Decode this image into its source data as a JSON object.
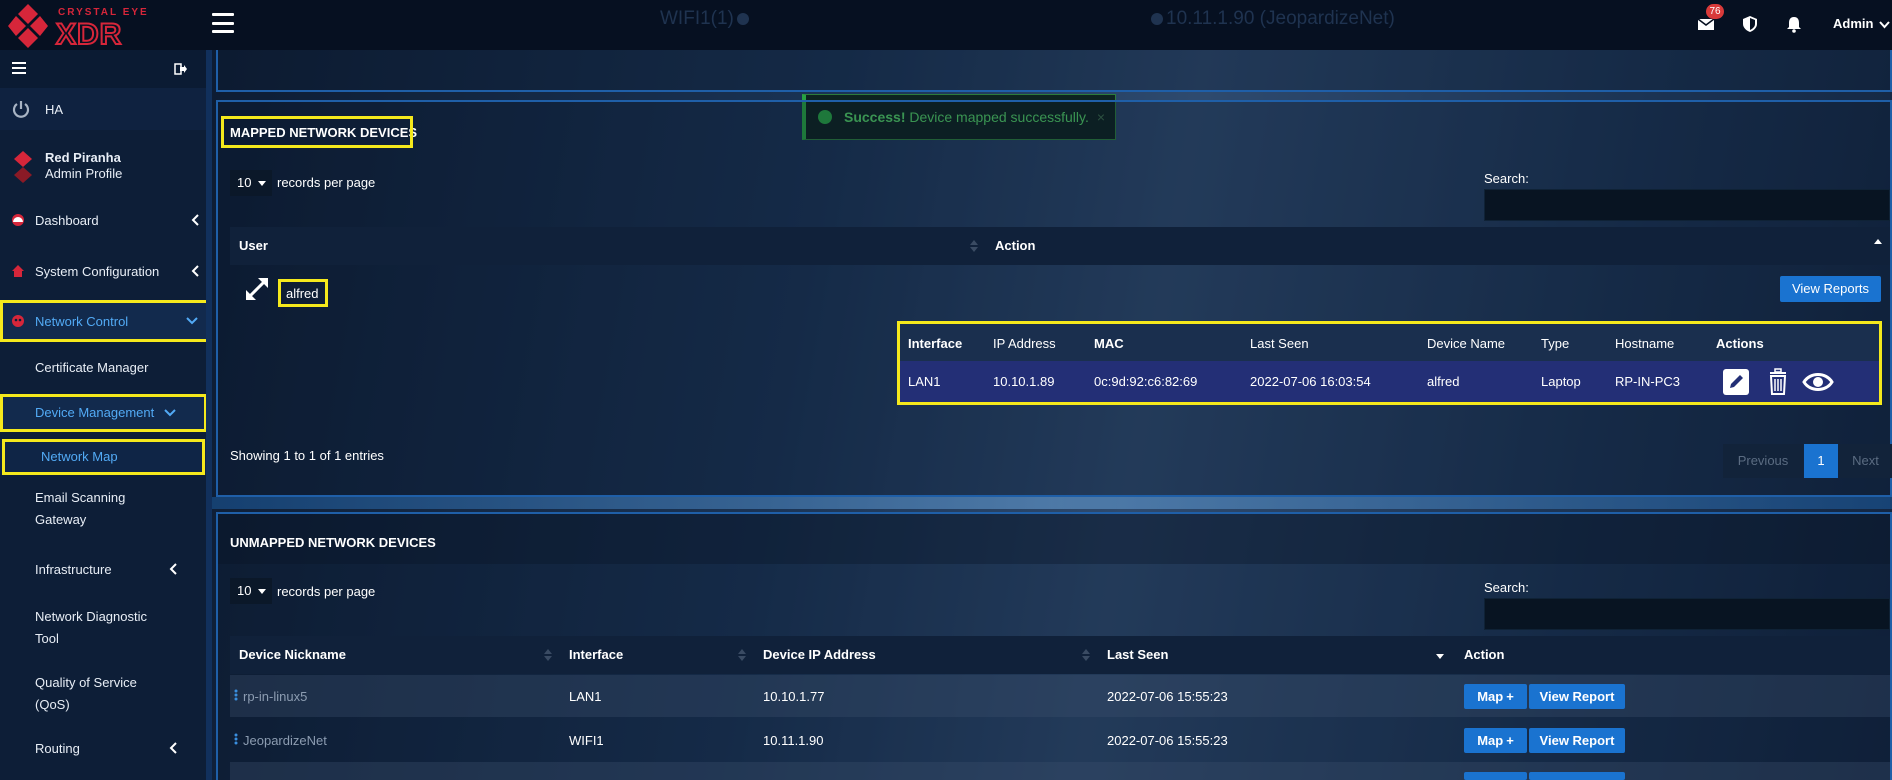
{
  "topbar": {
    "brand_top": "CRYSTAL EYE",
    "brand_main": "XDR",
    "status_left": "WIFI1(1)",
    "status_right": "10.11.1.90 (JeopardizeNet)",
    "mail_badge": "76",
    "user": "Admin"
  },
  "sidebar": {
    "ha_label": "HA",
    "profile_name": "Red Piranha",
    "profile_role": "Admin Profile",
    "items": [
      {
        "label": "Dashboard"
      },
      {
        "label": "System Configuration"
      },
      {
        "label": "Network Control"
      },
      {
        "label": "Certificate Manager"
      },
      {
        "label": "Device Management"
      },
      {
        "label": "Network Map"
      },
      {
        "label_1": "Email Scanning",
        "label_2": "Gateway"
      },
      {
        "label": "Infrastructure"
      },
      {
        "label_1": "Network Diagnostic",
        "label_2": "Tool"
      },
      {
        "label_1": "Quality of Service",
        "label_2": "(QoS)"
      },
      {
        "label": "Routing"
      }
    ]
  },
  "toast": {
    "strong": "Success!",
    "message": "Device mapped successfully.",
    "close": "×"
  },
  "mapped": {
    "title": "MAPPED NETWORK DEVICES",
    "rpp_value": "10",
    "rpp_text": "records per page",
    "search_label": "Search:",
    "search_value": "",
    "headers": {
      "user": "User",
      "action": "Action"
    },
    "row": {
      "user": "alfred",
      "view_reports": "View Reports"
    },
    "details": {
      "headers": [
        "Interface",
        "IP Address",
        "MAC",
        "Last Seen",
        "Device Name",
        "Type",
        "Hostname",
        "Actions"
      ],
      "row": [
        "LAN1",
        "10.10.1.89",
        "0c:9d:92:c6:82:69",
        "2022-07-06 16:03:54",
        "alfred",
        "Laptop",
        "RP-IN-PC3"
      ]
    },
    "showing": "Showing 1 to 1 of 1 entries",
    "pagination": {
      "prev": "Previous",
      "page": "1",
      "next": "Next"
    }
  },
  "unmapped": {
    "title": "UNMAPPED NETWORK DEVICES",
    "rpp_value": "10",
    "rpp_text": "records per page",
    "search_label": "Search:",
    "search_value": "",
    "headers": [
      "Device Nickname",
      "Interface",
      "Device IP Address",
      "Last Seen",
      "Action"
    ],
    "rows": [
      {
        "nickname": "rp-in-linux5",
        "interface": "LAN1",
        "ip": "10.10.1.77",
        "last_seen": "2022-07-06 15:55:23",
        "map": "Map",
        "view": "View Report"
      },
      {
        "nickname": "JeopardizeNet",
        "interface": "WIFI1",
        "ip": "10.11.1.90",
        "last_seen": "2022-07-06 15:55:23",
        "map": "Map",
        "view": "View Report"
      }
    ]
  },
  "colors": {
    "accent": "#1a73d0",
    "highlight": "#f5e91c",
    "success": "#27a243",
    "brand_red": "#d6263a"
  }
}
